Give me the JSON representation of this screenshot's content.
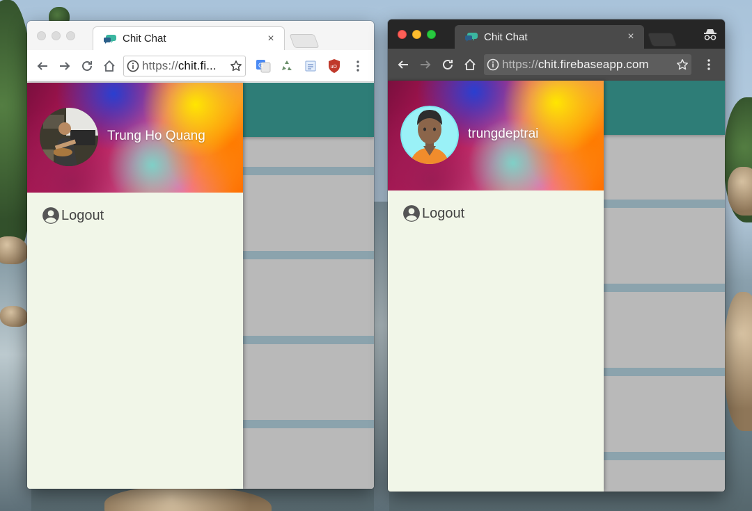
{
  "windows": [
    {
      "theme": "light",
      "tab": {
        "title": "Chit Chat",
        "close": "×"
      },
      "toolbar": {
        "url_scheme": "https://",
        "url_host": "chit.fi..."
      },
      "extensions": [
        "google-translate-icon",
        "recycle-icon",
        "notepad-icon",
        "ublock-icon"
      ],
      "drawer": {
        "user_name": "Trung Ho Quang",
        "logout_label": "Logout"
      }
    },
    {
      "theme": "dark",
      "tab": {
        "title": "Chit Chat",
        "close": "×"
      },
      "toolbar": {
        "url_scheme": "https://",
        "url_host": "chit.firebaseapp.com"
      },
      "drawer": {
        "user_name": "trungdeptrai",
        "logout_label": "Logout"
      }
    }
  ],
  "colors": {
    "appbar": "#2e7d77",
    "drawer_bg": "#f1f6e8",
    "list_stripe": "#8ba3ad",
    "page_bg": "#b9b9b9"
  }
}
